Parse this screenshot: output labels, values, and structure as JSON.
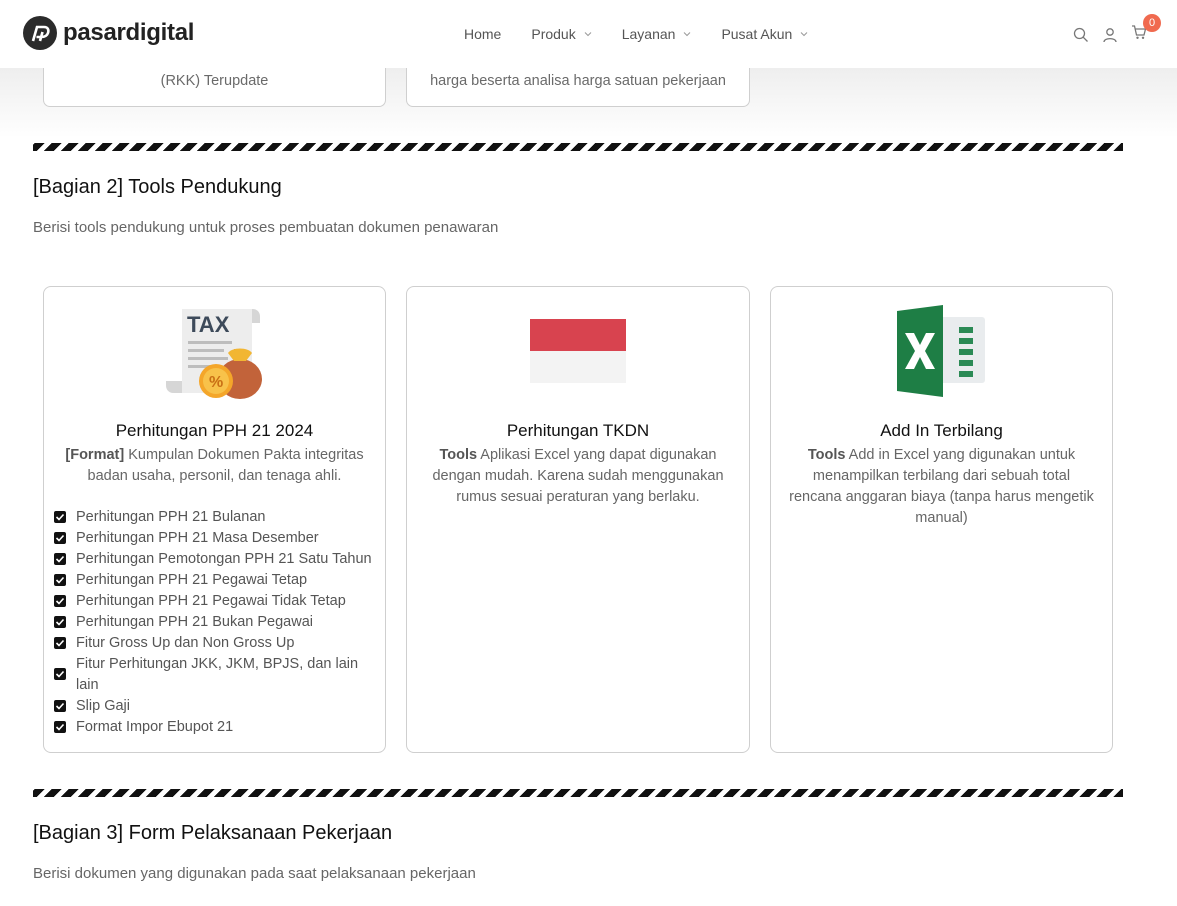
{
  "header": {
    "logo_text": "pasardigital",
    "nav": [
      {
        "label": "Home",
        "has_dropdown": false
      },
      {
        "label": "Produk",
        "has_dropdown": true
      },
      {
        "label": "Layanan",
        "has_dropdown": true
      },
      {
        "label": "Pusat Akun",
        "has_dropdown": true
      }
    ],
    "icons": [
      "search-icon",
      "user-icon",
      "cart-icon"
    ],
    "cart_count": "0"
  },
  "top_cards": [
    {
      "text": "(RKK) Terupdate"
    },
    {
      "text": "harga beserta analisa harga satuan pekerjaan"
    }
  ],
  "section2": {
    "title": "[Bagian 2] Tools Pendukung",
    "description": "Berisi tools pendukung untuk proses pembuatan dokumen penawaran",
    "cards": [
      {
        "image": "tax-money-bag-icon",
        "title": "Perhitungan PPH 21 2024",
        "desc_bold": "[Format]",
        "desc_rest": " Kumpulan Dokumen Pakta integritas badan usaha, personil, dan tenaga ahli.",
        "checklist": [
          "Perhitungan PPH 21 Bulanan",
          "Perhitungan PPH 21 Masa Desember",
          "Perhitungan Pemotongan PPH 21 Satu Tahun",
          "Perhitungan PPH 21 Pegawai Tetap",
          "Perhitungan PPH 21 Pegawai Tidak Tetap",
          "Perhitungan PPH 21 Bukan Pegawai",
          "Fitur Gross Up dan Non Gross Up",
          "Fitur Perhitungan JKK, JKM, BPJS, dan lain lain",
          "Slip Gaji",
          "Format Impor Ebupot 21"
        ]
      },
      {
        "image": "indonesia-flag-icon",
        "title": "Perhitungan TKDN",
        "desc_bold": "Tools",
        "desc_rest": " Aplikasi Excel yang dapat digunakan dengan mudah. Karena sudah menggunakan rumus sesuai peraturan yang berlaku."
      },
      {
        "image": "excel-icon",
        "title": "Add In Terbilang",
        "desc_bold": "Tools",
        "desc_rest": " Add in Excel yang digunakan untuk menampilkan terbilang dari sebuah total rencana anggaran biaya (tanpa harus mengetik manual)"
      }
    ]
  },
  "section3": {
    "title": "[Bagian 3] Form Pelaksanaan Pekerjaan",
    "description": "Berisi dokumen yang digunakan pada saat pelaksanaan pekerjaan"
  },
  "colors": {
    "accent_badge": "#f06a4f",
    "excel_green": "#1e7e45",
    "flag_red": "#d8434f"
  }
}
